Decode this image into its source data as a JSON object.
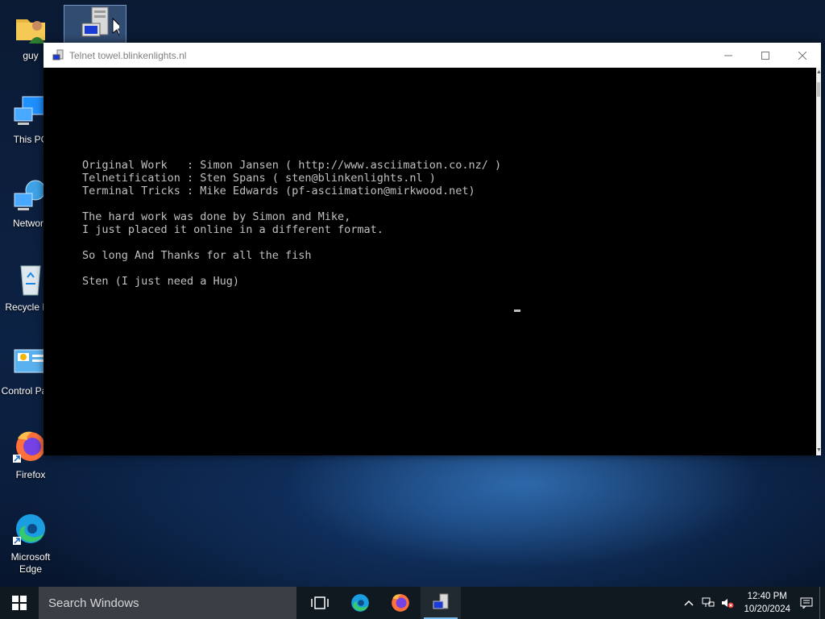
{
  "desktop": {
    "icons": [
      {
        "label": "guy"
      },
      {
        "label": "This PC"
      },
      {
        "label": "Network"
      },
      {
        "label": "Recycle Bin"
      },
      {
        "label": "Control Panel"
      },
      {
        "label": "Firefox"
      },
      {
        "label": "Microsoft Edge"
      }
    ],
    "selected_icon": "telnet-shortcut-icon"
  },
  "window": {
    "title": "Telnet towel.blinkenlights.nl",
    "controls": {
      "minimize": "—",
      "maximize": "☐",
      "close": "✕"
    }
  },
  "terminal": {
    "lines": [
      "Original Work   : Simon Jansen ( http://www.asciimation.co.nz/ )",
      "Telnetification : Sten Spans ( sten@blinkenlights.nl )",
      "Terminal Tricks : Mike Edwards (pf-asciimation@mirkwood.net)",
      "",
      "The hard work was done by Simon and Mike,",
      "I just placed it online in a different format.",
      "",
      "So long And Thanks for all the fish",
      "",
      "Sten (I just need a Hug)"
    ]
  },
  "taskbar": {
    "search_placeholder": "Search Windows",
    "time": "12:40 PM",
    "date": "10/20/2024",
    "pinned": [
      "task-view-icon",
      "edge-icon",
      "firefox-icon",
      "telnet-icon"
    ]
  },
  "colors": {
    "terminal_bg": "#000000",
    "terminal_fg": "#c0c0c0",
    "taskbar_bg": "#101820",
    "accent": "#76b9ed"
  }
}
